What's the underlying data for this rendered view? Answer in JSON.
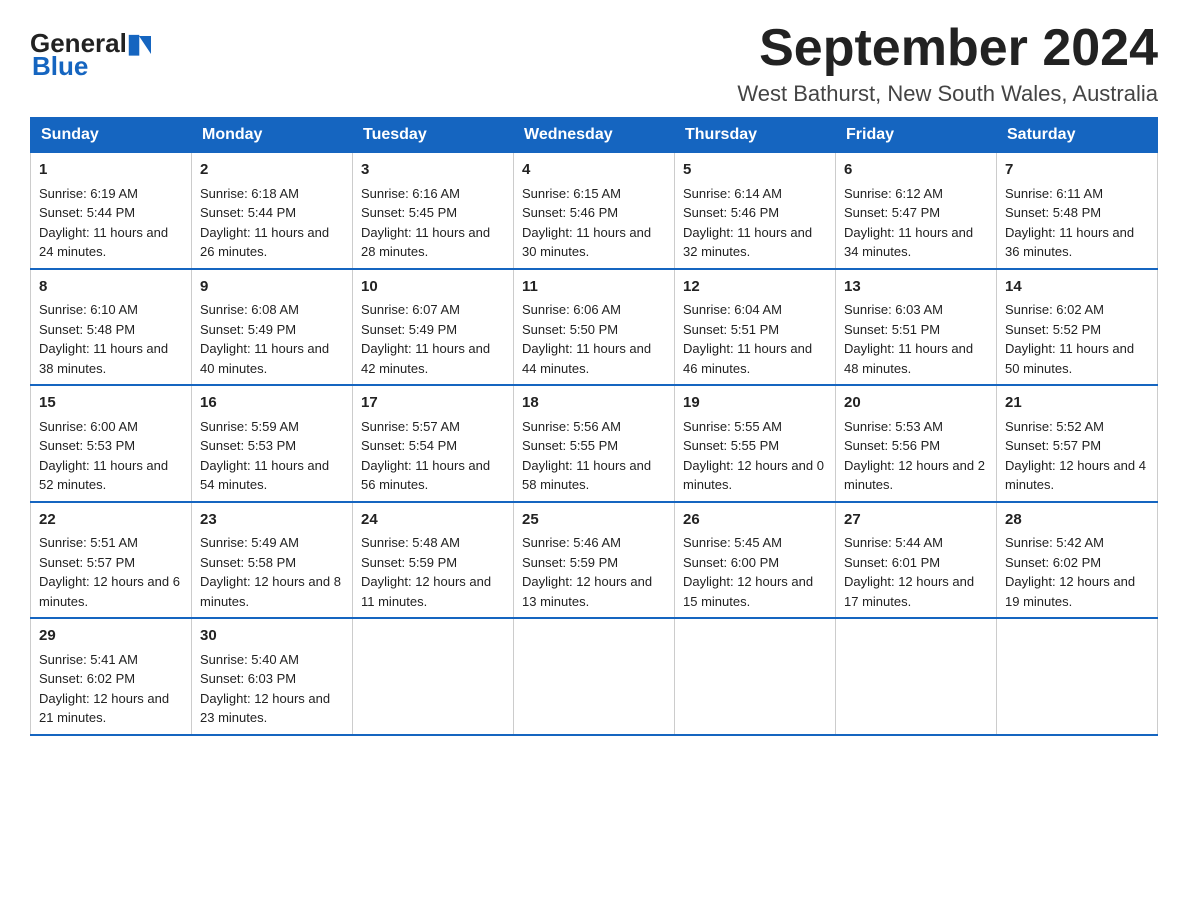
{
  "logo": {
    "general": "General",
    "blue": "Blue"
  },
  "header": {
    "title": "September 2024",
    "subtitle": "West Bathurst, New South Wales, Australia"
  },
  "days": [
    "Sunday",
    "Monday",
    "Tuesday",
    "Wednesday",
    "Thursday",
    "Friday",
    "Saturday"
  ],
  "weeks": [
    [
      {
        "num": "1",
        "sunrise": "6:19 AM",
        "sunset": "5:44 PM",
        "daylight": "11 hours and 24 minutes."
      },
      {
        "num": "2",
        "sunrise": "6:18 AM",
        "sunset": "5:44 PM",
        "daylight": "11 hours and 26 minutes."
      },
      {
        "num": "3",
        "sunrise": "6:16 AM",
        "sunset": "5:45 PM",
        "daylight": "11 hours and 28 minutes."
      },
      {
        "num": "4",
        "sunrise": "6:15 AM",
        "sunset": "5:46 PM",
        "daylight": "11 hours and 30 minutes."
      },
      {
        "num": "5",
        "sunrise": "6:14 AM",
        "sunset": "5:46 PM",
        "daylight": "11 hours and 32 minutes."
      },
      {
        "num": "6",
        "sunrise": "6:12 AM",
        "sunset": "5:47 PM",
        "daylight": "11 hours and 34 minutes."
      },
      {
        "num": "7",
        "sunrise": "6:11 AM",
        "sunset": "5:48 PM",
        "daylight": "11 hours and 36 minutes."
      }
    ],
    [
      {
        "num": "8",
        "sunrise": "6:10 AM",
        "sunset": "5:48 PM",
        "daylight": "11 hours and 38 minutes."
      },
      {
        "num": "9",
        "sunrise": "6:08 AM",
        "sunset": "5:49 PM",
        "daylight": "11 hours and 40 minutes."
      },
      {
        "num": "10",
        "sunrise": "6:07 AM",
        "sunset": "5:49 PM",
        "daylight": "11 hours and 42 minutes."
      },
      {
        "num": "11",
        "sunrise": "6:06 AM",
        "sunset": "5:50 PM",
        "daylight": "11 hours and 44 minutes."
      },
      {
        "num": "12",
        "sunrise": "6:04 AM",
        "sunset": "5:51 PM",
        "daylight": "11 hours and 46 minutes."
      },
      {
        "num": "13",
        "sunrise": "6:03 AM",
        "sunset": "5:51 PM",
        "daylight": "11 hours and 48 minutes."
      },
      {
        "num": "14",
        "sunrise": "6:02 AM",
        "sunset": "5:52 PM",
        "daylight": "11 hours and 50 minutes."
      }
    ],
    [
      {
        "num": "15",
        "sunrise": "6:00 AM",
        "sunset": "5:53 PM",
        "daylight": "11 hours and 52 minutes."
      },
      {
        "num": "16",
        "sunrise": "5:59 AM",
        "sunset": "5:53 PM",
        "daylight": "11 hours and 54 minutes."
      },
      {
        "num": "17",
        "sunrise": "5:57 AM",
        "sunset": "5:54 PM",
        "daylight": "11 hours and 56 minutes."
      },
      {
        "num": "18",
        "sunrise": "5:56 AM",
        "sunset": "5:55 PM",
        "daylight": "11 hours and 58 minutes."
      },
      {
        "num": "19",
        "sunrise": "5:55 AM",
        "sunset": "5:55 PM",
        "daylight": "12 hours and 0 minutes."
      },
      {
        "num": "20",
        "sunrise": "5:53 AM",
        "sunset": "5:56 PM",
        "daylight": "12 hours and 2 minutes."
      },
      {
        "num": "21",
        "sunrise": "5:52 AM",
        "sunset": "5:57 PM",
        "daylight": "12 hours and 4 minutes."
      }
    ],
    [
      {
        "num": "22",
        "sunrise": "5:51 AM",
        "sunset": "5:57 PM",
        "daylight": "12 hours and 6 minutes."
      },
      {
        "num": "23",
        "sunrise": "5:49 AM",
        "sunset": "5:58 PM",
        "daylight": "12 hours and 8 minutes."
      },
      {
        "num": "24",
        "sunrise": "5:48 AM",
        "sunset": "5:59 PM",
        "daylight": "12 hours and 11 minutes."
      },
      {
        "num": "25",
        "sunrise": "5:46 AM",
        "sunset": "5:59 PM",
        "daylight": "12 hours and 13 minutes."
      },
      {
        "num": "26",
        "sunrise": "5:45 AM",
        "sunset": "6:00 PM",
        "daylight": "12 hours and 15 minutes."
      },
      {
        "num": "27",
        "sunrise": "5:44 AM",
        "sunset": "6:01 PM",
        "daylight": "12 hours and 17 minutes."
      },
      {
        "num": "28",
        "sunrise": "5:42 AM",
        "sunset": "6:02 PM",
        "daylight": "12 hours and 19 minutes."
      }
    ],
    [
      {
        "num": "29",
        "sunrise": "5:41 AM",
        "sunset": "6:02 PM",
        "daylight": "12 hours and 21 minutes."
      },
      {
        "num": "30",
        "sunrise": "5:40 AM",
        "sunset": "6:03 PM",
        "daylight": "12 hours and 23 minutes."
      },
      null,
      null,
      null,
      null,
      null
    ]
  ]
}
